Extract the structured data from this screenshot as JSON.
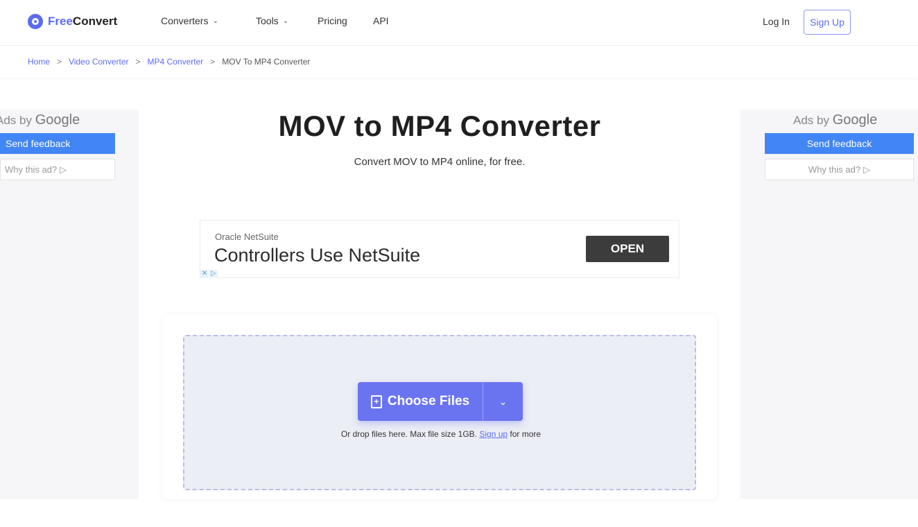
{
  "header": {
    "logo_free": "Free",
    "logo_convert": "Convert",
    "nav": [
      {
        "label": "Converters",
        "has_dropdown": true
      },
      {
        "label": "Tools",
        "has_dropdown": true
      },
      {
        "label": "Pricing",
        "has_dropdown": false
      },
      {
        "label": "API",
        "has_dropdown": false
      }
    ],
    "login": "Log In",
    "signup": "Sign Up",
    "accent_color": "#5b6cf2"
  },
  "breadcrumb": {
    "items": [
      "Home",
      "Video Converter",
      "MP4 Converter"
    ],
    "current": "MOV To MP4 Converter",
    "separator": ">"
  },
  "main": {
    "title": "MOV to MP4 Converter",
    "subtitle": "Convert MOV to MP4 online, for free."
  },
  "side_ad": {
    "ads_by": "Ads by",
    "google": "Google",
    "feedback": "Send feedback",
    "why": "Why this ad?",
    "why_icon": "▷",
    "feedback_color": "#4285f4"
  },
  "center_ad": {
    "advertiser": "Oracle NetSuite",
    "headline": "Controllers Use NetSuite",
    "cta": "OPEN"
  },
  "upload": {
    "choose_label": "Choose Files",
    "chevron": "⌄",
    "hint_prefix": "Or drop files here. Max file size 1GB.",
    "hint_link": "Sign up",
    "hint_suffix": "for more",
    "button_color": "#6b74f0"
  }
}
